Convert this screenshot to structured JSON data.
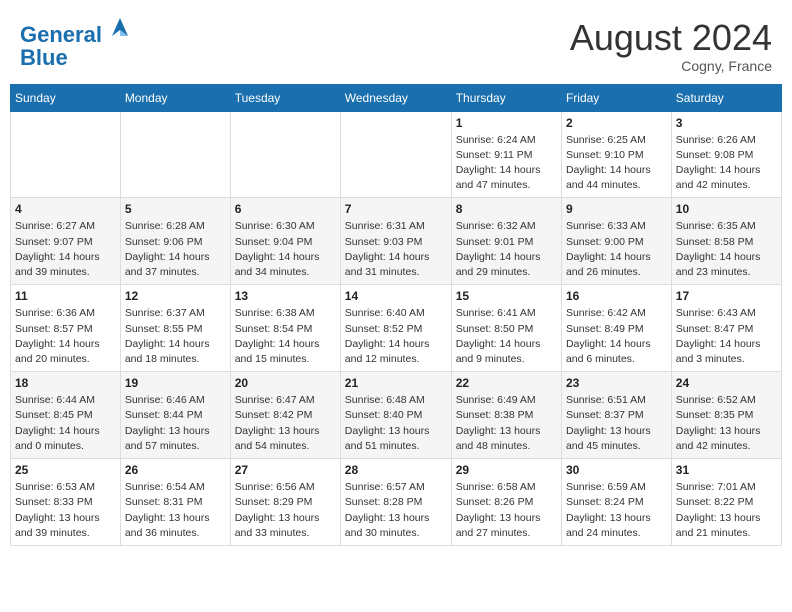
{
  "header": {
    "logo_line1": "General",
    "logo_line2": "Blue",
    "month_year": "August 2024",
    "location": "Cogny, France"
  },
  "weekdays": [
    "Sunday",
    "Monday",
    "Tuesday",
    "Wednesday",
    "Thursday",
    "Friday",
    "Saturday"
  ],
  "weeks": [
    [
      {
        "day": "",
        "info": ""
      },
      {
        "day": "",
        "info": ""
      },
      {
        "day": "",
        "info": ""
      },
      {
        "day": "",
        "info": ""
      },
      {
        "day": "1",
        "info": "Sunrise: 6:24 AM\nSunset: 9:11 PM\nDaylight: 14 hours\nand 47 minutes."
      },
      {
        "day": "2",
        "info": "Sunrise: 6:25 AM\nSunset: 9:10 PM\nDaylight: 14 hours\nand 44 minutes."
      },
      {
        "day": "3",
        "info": "Sunrise: 6:26 AM\nSunset: 9:08 PM\nDaylight: 14 hours\nand 42 minutes."
      }
    ],
    [
      {
        "day": "4",
        "info": "Sunrise: 6:27 AM\nSunset: 9:07 PM\nDaylight: 14 hours\nand 39 minutes."
      },
      {
        "day": "5",
        "info": "Sunrise: 6:28 AM\nSunset: 9:06 PM\nDaylight: 14 hours\nand 37 minutes."
      },
      {
        "day": "6",
        "info": "Sunrise: 6:30 AM\nSunset: 9:04 PM\nDaylight: 14 hours\nand 34 minutes."
      },
      {
        "day": "7",
        "info": "Sunrise: 6:31 AM\nSunset: 9:03 PM\nDaylight: 14 hours\nand 31 minutes."
      },
      {
        "day": "8",
        "info": "Sunrise: 6:32 AM\nSunset: 9:01 PM\nDaylight: 14 hours\nand 29 minutes."
      },
      {
        "day": "9",
        "info": "Sunrise: 6:33 AM\nSunset: 9:00 PM\nDaylight: 14 hours\nand 26 minutes."
      },
      {
        "day": "10",
        "info": "Sunrise: 6:35 AM\nSunset: 8:58 PM\nDaylight: 14 hours\nand 23 minutes."
      }
    ],
    [
      {
        "day": "11",
        "info": "Sunrise: 6:36 AM\nSunset: 8:57 PM\nDaylight: 14 hours\nand 20 minutes."
      },
      {
        "day": "12",
        "info": "Sunrise: 6:37 AM\nSunset: 8:55 PM\nDaylight: 14 hours\nand 18 minutes."
      },
      {
        "day": "13",
        "info": "Sunrise: 6:38 AM\nSunset: 8:54 PM\nDaylight: 14 hours\nand 15 minutes."
      },
      {
        "day": "14",
        "info": "Sunrise: 6:40 AM\nSunset: 8:52 PM\nDaylight: 14 hours\nand 12 minutes."
      },
      {
        "day": "15",
        "info": "Sunrise: 6:41 AM\nSunset: 8:50 PM\nDaylight: 14 hours\nand 9 minutes."
      },
      {
        "day": "16",
        "info": "Sunrise: 6:42 AM\nSunset: 8:49 PM\nDaylight: 14 hours\nand 6 minutes."
      },
      {
        "day": "17",
        "info": "Sunrise: 6:43 AM\nSunset: 8:47 PM\nDaylight: 14 hours\nand 3 minutes."
      }
    ],
    [
      {
        "day": "18",
        "info": "Sunrise: 6:44 AM\nSunset: 8:45 PM\nDaylight: 14 hours\nand 0 minutes."
      },
      {
        "day": "19",
        "info": "Sunrise: 6:46 AM\nSunset: 8:44 PM\nDaylight: 13 hours\nand 57 minutes."
      },
      {
        "day": "20",
        "info": "Sunrise: 6:47 AM\nSunset: 8:42 PM\nDaylight: 13 hours\nand 54 minutes."
      },
      {
        "day": "21",
        "info": "Sunrise: 6:48 AM\nSunset: 8:40 PM\nDaylight: 13 hours\nand 51 minutes."
      },
      {
        "day": "22",
        "info": "Sunrise: 6:49 AM\nSunset: 8:38 PM\nDaylight: 13 hours\nand 48 minutes."
      },
      {
        "day": "23",
        "info": "Sunrise: 6:51 AM\nSunset: 8:37 PM\nDaylight: 13 hours\nand 45 minutes."
      },
      {
        "day": "24",
        "info": "Sunrise: 6:52 AM\nSunset: 8:35 PM\nDaylight: 13 hours\nand 42 minutes."
      }
    ],
    [
      {
        "day": "25",
        "info": "Sunrise: 6:53 AM\nSunset: 8:33 PM\nDaylight: 13 hours\nand 39 minutes."
      },
      {
        "day": "26",
        "info": "Sunrise: 6:54 AM\nSunset: 8:31 PM\nDaylight: 13 hours\nand 36 minutes."
      },
      {
        "day": "27",
        "info": "Sunrise: 6:56 AM\nSunset: 8:29 PM\nDaylight: 13 hours\nand 33 minutes."
      },
      {
        "day": "28",
        "info": "Sunrise: 6:57 AM\nSunset: 8:28 PM\nDaylight: 13 hours\nand 30 minutes."
      },
      {
        "day": "29",
        "info": "Sunrise: 6:58 AM\nSunset: 8:26 PM\nDaylight: 13 hours\nand 27 minutes."
      },
      {
        "day": "30",
        "info": "Sunrise: 6:59 AM\nSunset: 8:24 PM\nDaylight: 13 hours\nand 24 minutes."
      },
      {
        "day": "31",
        "info": "Sunrise: 7:01 AM\nSunset: 8:22 PM\nDaylight: 13 hours\nand 21 minutes."
      }
    ]
  ]
}
